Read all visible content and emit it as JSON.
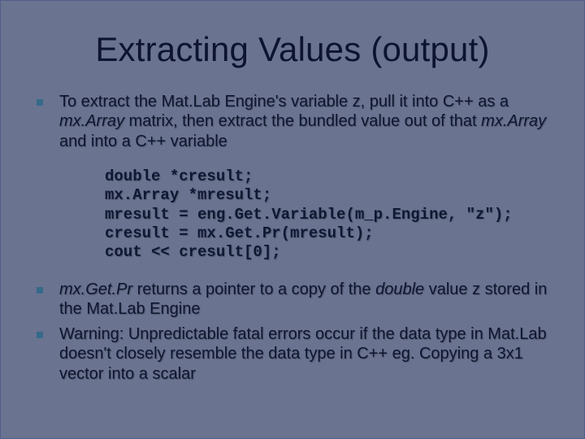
{
  "slide": {
    "title": "Extracting Values (output)",
    "bullet1_a": "To extract the Mat.Lab Engine's variable z, pull it into C++ as a ",
    "bullet1_ital1": "mx.Array",
    "bullet1_b": " matrix, then extract the bundled value out of that ",
    "bullet1_ital2": "mx.Array",
    "bullet1_c": " and into a C++ variable",
    "code": "double *cresult;\nmx.Array *mresult;\nmresult = eng.Get.Variable(m_p.Engine, \"z\");\ncresult = mx.Get.Pr(mresult);\ncout << cresult[0];",
    "bullet2_ital1": "mx.Get.Pr",
    "bullet2_a": " returns a pointer to a copy of the ",
    "bullet2_ital2": "double",
    "bullet2_b": " value z stored in the Mat.Lab Engine",
    "bullet3": "Warning: Unpredictable fatal errors occur if the data type in Mat.Lab doesn't closely resemble the data type in C++ eg. Copying a 3x1 vector into a scalar"
  }
}
